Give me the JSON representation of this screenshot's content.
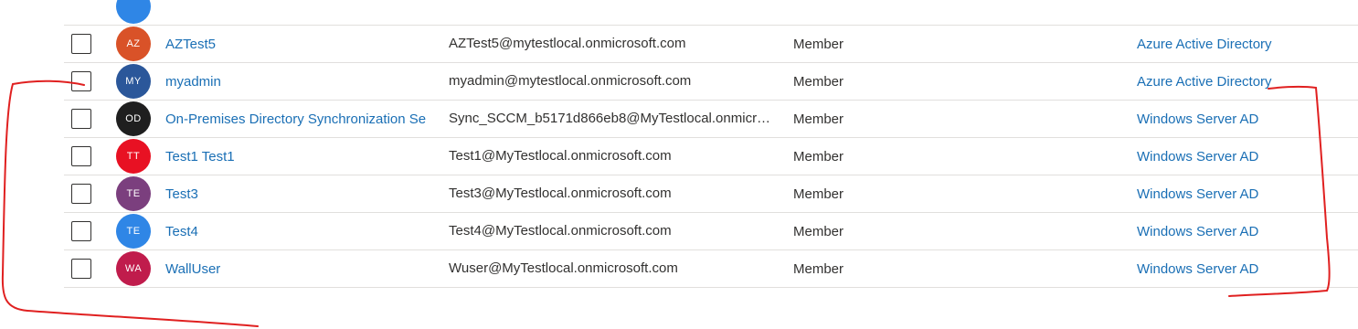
{
  "users": [
    {
      "initials": "",
      "name": "",
      "upn": "",
      "type": "",
      "source": "",
      "avatar_color": "#2f86e6"
    },
    {
      "initials": "AZ",
      "name": "AZTest5",
      "upn": "AZTest5@mytestlocal.onmicrosoft.com",
      "type": "Member",
      "source": "Azure Active Directory",
      "avatar_color": "#d95228"
    },
    {
      "initials": "MY",
      "name": "myadmin",
      "upn": "myadmin@mytestlocal.onmicrosoft.com",
      "type": "Member",
      "source": "Azure Active Directory",
      "avatar_color": "#2b579a"
    },
    {
      "initials": "OD",
      "name": "On-Premises Directory Synchronization Se",
      "upn": "Sync_SCCM_b5171d866eb8@MyTestlocal.onmicr…",
      "type": "Member",
      "source": "Windows Server AD",
      "avatar_color": "#1f1f1f"
    },
    {
      "initials": "TT",
      "name": "Test1 Test1",
      "upn": "Test1@MyTestlocal.onmicrosoft.com",
      "type": "Member",
      "source": "Windows Server AD",
      "avatar_color": "#e81123"
    },
    {
      "initials": "TE",
      "name": "Test3",
      "upn": "Test3@MyTestlocal.onmicrosoft.com",
      "type": "Member",
      "source": "Windows Server AD",
      "avatar_color": "#7b3f7e"
    },
    {
      "initials": "TE",
      "name": "Test4",
      "upn": "Test4@MyTestlocal.onmicrosoft.com",
      "type": "Member",
      "source": "Windows Server AD",
      "avatar_color": "#2f86e6"
    },
    {
      "initials": "WA",
      "name": "WallUser",
      "upn": "Wuser@MyTestlocal.onmicrosoft.com",
      "type": "Member",
      "source": "Windows Server AD",
      "avatar_color": "#c01c4c"
    }
  ],
  "annotation_color": "#e02020"
}
